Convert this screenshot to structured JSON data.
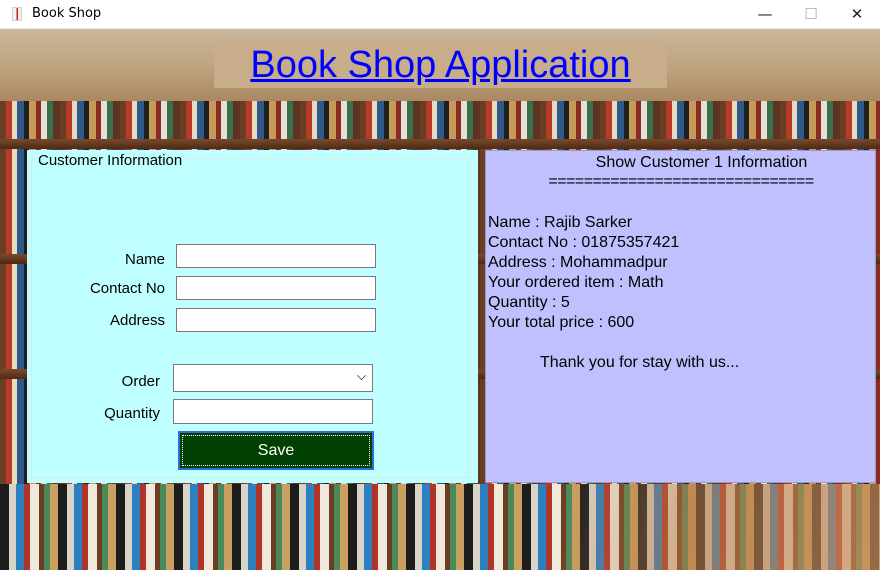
{
  "window": {
    "title": "Book Shop",
    "minimize_glyph": "—",
    "maximize_glyph": "☐",
    "close_glyph": "✕"
  },
  "app": {
    "heading": "Book Shop Application"
  },
  "customer_form": {
    "group_title": "Customer Information",
    "name_label": "Name",
    "name_value": "",
    "contact_label": "Contact No",
    "contact_value": "",
    "address_label": "Address",
    "address_value": "",
    "order_label": "Order",
    "order_value": "",
    "quantity_label": "Quantity",
    "quantity_value": "",
    "save_label": "Save"
  },
  "info_panel": {
    "title": "Show Customer 1 Information",
    "divider": "==============================",
    "lines": [
      "Name : Rajib Sarker",
      "Contact No : 01875357421",
      "Address : Mohammadpur",
      "Your ordered item : Math",
      "Quantity : 5",
      "Your total price : 600"
    ],
    "thanks": "Thank you for stay with us..."
  },
  "colors": {
    "form_background": "#c0ffff",
    "info_background": "#c0c0ff",
    "save_button": "#004000",
    "heading_text": "#0000ff"
  }
}
